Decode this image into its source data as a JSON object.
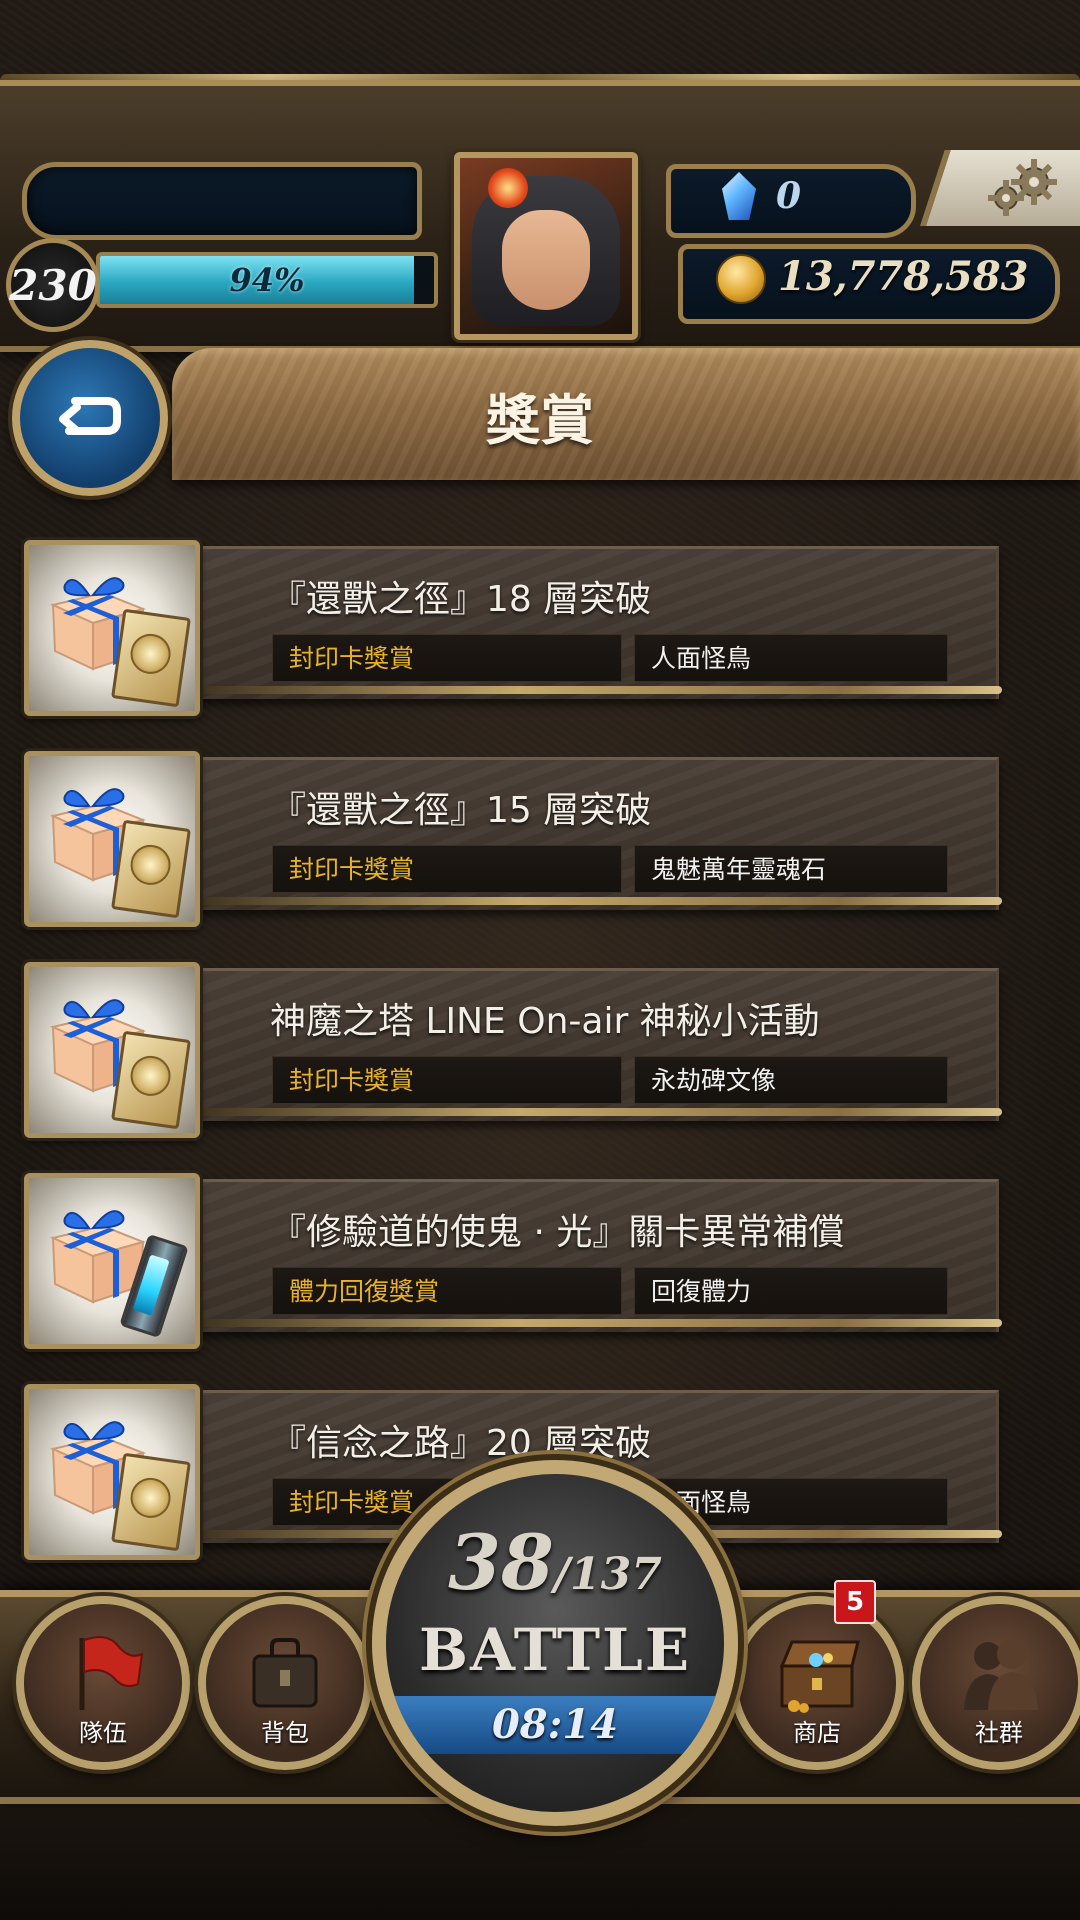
{
  "header": {
    "player_name": "",
    "level": "230",
    "xp_percent_label": "94%",
    "xp_fraction": 0.94,
    "gems": "0",
    "coins": "13,778,583"
  },
  "page_title": "獎賞",
  "rewards": [
    {
      "title": "『還獸之徑』18 層突破",
      "type": "封印卡獎賞",
      "item": "人面怪鳥",
      "icon": "gift-card-icon"
    },
    {
      "title": "『還獸之徑』15 層突破",
      "type": "封印卡獎賞",
      "item": "鬼魅萬年靈魂石",
      "icon": "gift-card-icon"
    },
    {
      "title": "神魔之塔 LINE On-air 神秘小活動",
      "type": "封印卡獎賞",
      "item": "永劫碑文像",
      "icon": "gift-card-icon"
    },
    {
      "title": "『修驗道的使鬼 · 光』關卡異常補償",
      "type": "體力回復獎賞",
      "item": "回復體力",
      "icon": "gift-potion-icon"
    },
    {
      "title": "『信念之路』20 層突破",
      "type": "封印卡獎賞",
      "item": "人面怪鳥",
      "icon": "gift-card-icon"
    }
  ],
  "battle": {
    "current": "38",
    "max": "/137",
    "label": "BATTLE",
    "timer": "08:14"
  },
  "nav": {
    "team": "隊伍",
    "bag": "背包",
    "shop": "商店",
    "shop_badge": "5",
    "social": "社群"
  },
  "colors": {
    "accent_gold": "#e8b22a",
    "xp_cyan": "#2aa8c2",
    "battle_blue": "#164a86",
    "badge_red": "#c8161a"
  }
}
